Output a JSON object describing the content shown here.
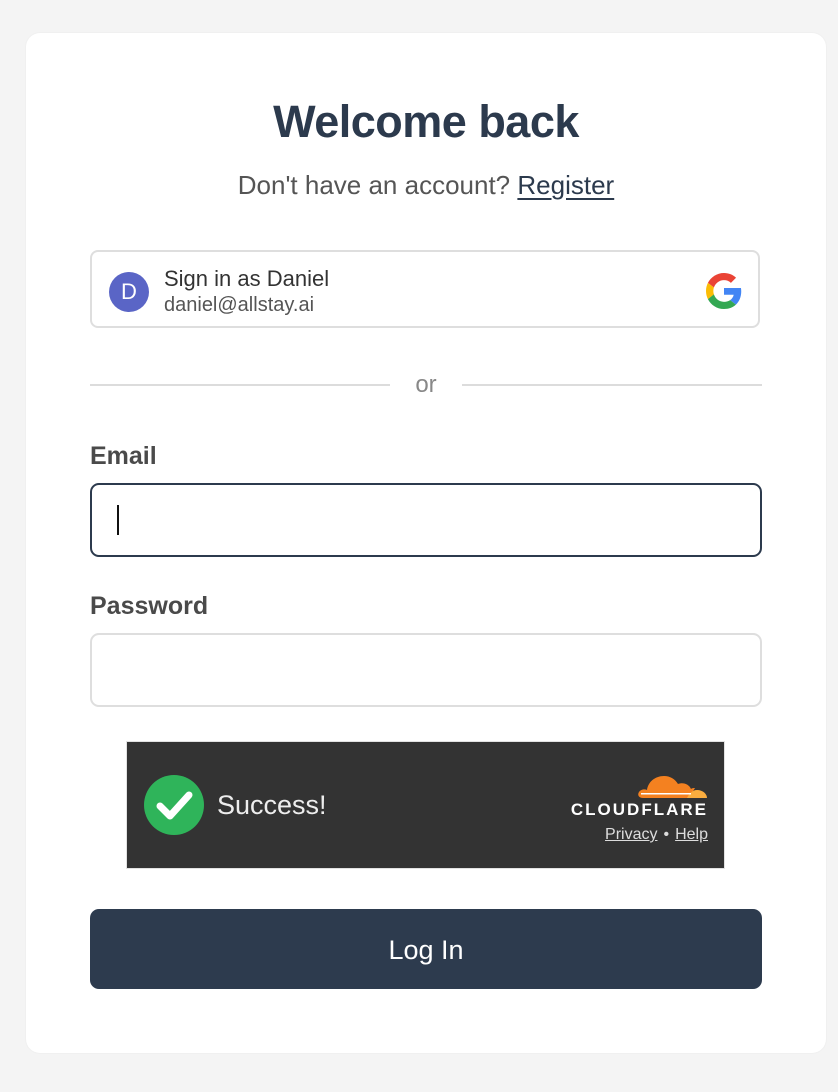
{
  "header": {
    "title": "Welcome back",
    "subtitle_prefix": "Don't have an account?",
    "register_link": "Register"
  },
  "google_signin": {
    "avatar_initial": "D",
    "name_line": "Sign in as Daniel",
    "email": "daniel@allstay.ai",
    "icon": "google-g-icon"
  },
  "divider": {
    "text": "or"
  },
  "form": {
    "email_label": "Email",
    "email_value": "",
    "password_label": "Password",
    "password_value": ""
  },
  "captcha": {
    "status": "Success!",
    "status_icon": "check-circle-icon",
    "brand": "CLOUDFLARE",
    "brand_icon": "cloudflare-cloud-icon",
    "privacy_link": "Privacy",
    "separator": "•",
    "help_link": "Help"
  },
  "actions": {
    "login_label": "Log In"
  },
  "colors": {
    "primary": "#2d3b4e",
    "avatar": "#5a65c6",
    "success": "#2fb45a",
    "cloudflare_orange": "#f48120",
    "captcha_bg": "#333333"
  }
}
